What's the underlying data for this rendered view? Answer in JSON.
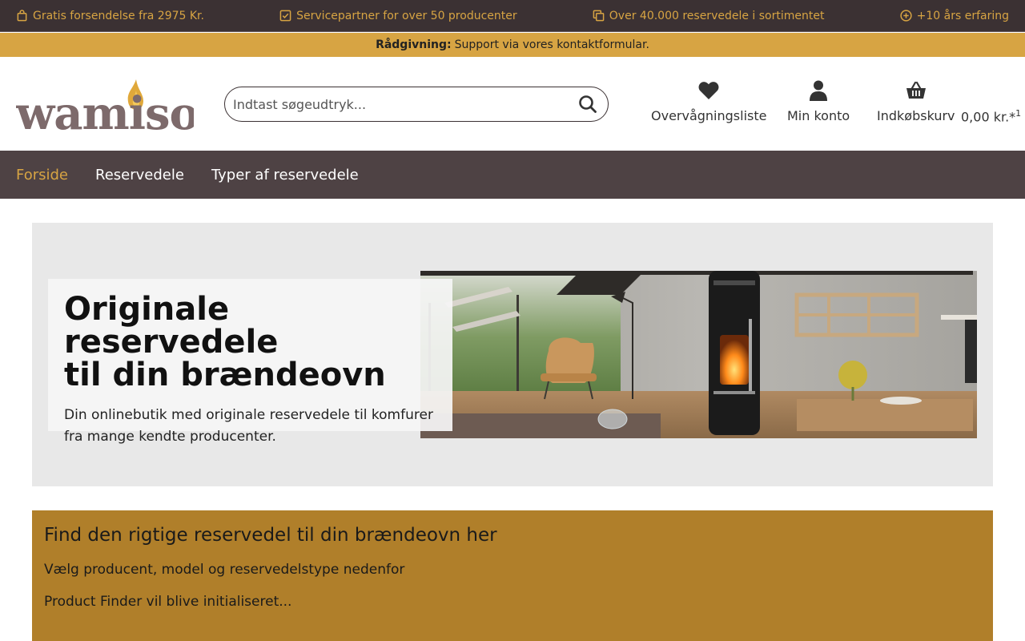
{
  "topbar": {
    "items": [
      {
        "icon": "bag-icon",
        "text": "Gratis forsendelse fra 2975 Kr."
      },
      {
        "icon": "check-square-icon",
        "text": "Servicepartner for over 50 producenter"
      },
      {
        "icon": "copy-icon",
        "text": "Over 40.000 reservedele i sortimentet"
      },
      {
        "icon": "plus-circle-icon",
        "text": "+10 års erfaring"
      }
    ]
  },
  "advice": {
    "label": "Rådgivning:",
    "text": "Support via vores",
    "link": "kontaktformular."
  },
  "header": {
    "logo_text": "wamiso",
    "search_placeholder": "Indtast søgeudtryk...",
    "wishlist_label": "Overvågningsliste",
    "account_label": "Min konto",
    "cart_label": "Indkøbskurv",
    "cart_total": "0,00 kr.*",
    "cart_footnote": "1"
  },
  "nav": {
    "items": [
      {
        "label": "Forside",
        "active": true
      },
      {
        "label": "Reservedele",
        "active": false
      },
      {
        "label": "Typer af reservedele",
        "active": false
      }
    ]
  },
  "hero": {
    "title_line1": "Originale reservedele",
    "title_line2": "til din brændeovn",
    "subtitle_line1": "Din onlinebutik med originale reservedele til komfurer",
    "subtitle_line2": "fra mange kendte producenter."
  },
  "finder": {
    "title": "Find den rigtige reservedel til din brændeovn her",
    "instruction": "Vælg producent, model og reservedelstype nedenfor",
    "status": "Product Finder vil blive initialiseret..."
  },
  "colors": {
    "topbar_bg": "#3b3133",
    "accent_gold": "#d7a443",
    "nav_bg": "#4e4244",
    "finder_bg": "#b07f2a",
    "logo_text": "#7d6a6b"
  }
}
